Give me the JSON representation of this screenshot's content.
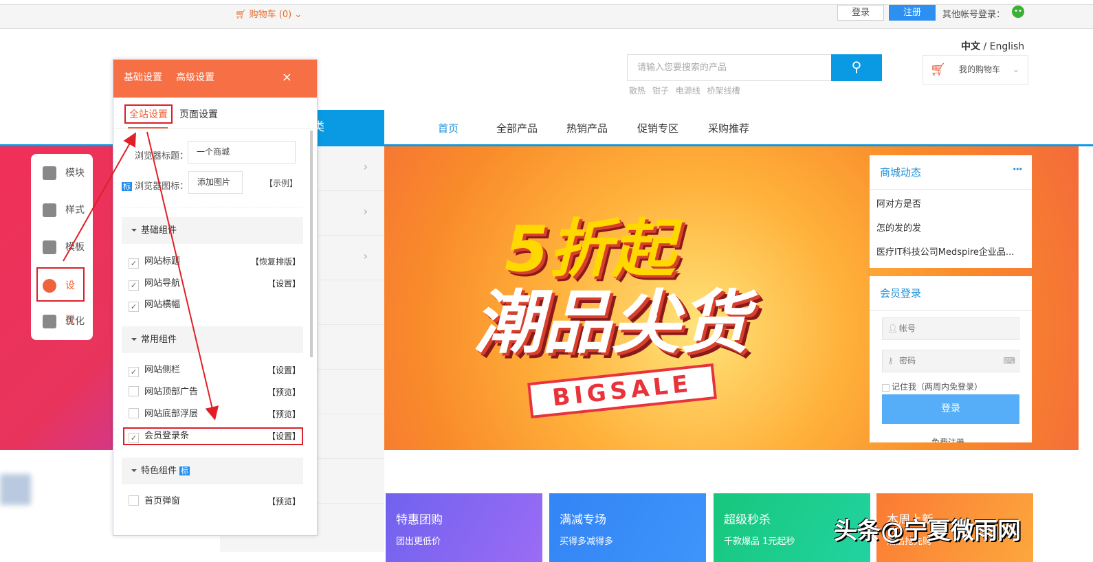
{
  "topbar": {
    "cart": "购物车 (0)",
    "login": "登录",
    "register": "注册",
    "other_login": "其他帐号登录：",
    "wechat_icon": "wechat-icon"
  },
  "header": {
    "lang_zh": "中文",
    "lang_sep": " / ",
    "lang_en": "English",
    "search_placeholder": "请输入您要搜索的产品",
    "hot": [
      "散热",
      "钳子",
      "电源线",
      "桥架线槽"
    ],
    "my_cart": "我的购物车"
  },
  "nav": {
    "category": "类",
    "items": [
      "首页",
      "全部产品",
      "热销产品",
      "促销专区",
      "采购推荐"
    ],
    "active_color": "#1d8fd6"
  },
  "banner": {
    "line1": "5折起",
    "line2": "潮品尖货",
    "tag": "BIGSALE"
  },
  "news": {
    "title": "商城动态",
    "more": "•••",
    "items": [
      "阿对方是否",
      "怎的发的发",
      "医疗IT科技公司Medspire企业品..."
    ]
  },
  "member": {
    "title": "会员登录",
    "account": "帐号",
    "password": "密码",
    "remember": "记住我（两周内免登录）",
    "login": "登录",
    "register": "免费注册"
  },
  "promos": [
    {
      "title": "特惠团购",
      "sub": "团出更低价",
      "color": "#7b61f0"
    },
    {
      "title": "满减专场",
      "sub": "买得多减得多",
      "color": "#3b8cf6"
    },
    {
      "title": "超级秒杀",
      "sub": "千款爆品 1元起秒",
      "color": "#1fcf8e"
    },
    {
      "title": "本周上新",
      "sub": "潮品抢先购",
      "color": "#fb8a3a"
    }
  ],
  "watermark": "头条@宁夏微雨网",
  "tools": [
    {
      "label": "模块"
    },
    {
      "label": "样式"
    },
    {
      "label": "模板"
    },
    {
      "label": "设置"
    },
    {
      "label": "优化"
    }
  ],
  "panel": {
    "tabs": [
      "基础设置",
      "高级设置"
    ],
    "close": "×",
    "subtabs": [
      "全站设置",
      "页面设置"
    ],
    "browser_title_label": "浏览器标题：",
    "browser_title_value": "一个商城",
    "badge": "标",
    "browser_icon_label": "浏览器图标：",
    "add_image": "添加图片",
    "example": "【示例】",
    "sections": [
      {
        "title": "基础组件",
        "rows": [
          {
            "label": "网站标题",
            "checked": true,
            "action": "【恢复排版】"
          },
          {
            "label": "网站导航",
            "checked": true,
            "action": "【设置】"
          },
          {
            "label": "网站横幅",
            "checked": true,
            "action": ""
          }
        ]
      },
      {
        "title": "常用组件",
        "rows": [
          {
            "label": "网站侧栏",
            "checked": true,
            "action": "【设置】"
          },
          {
            "label": "网站顶部广告",
            "checked": false,
            "action": "【预览】"
          },
          {
            "label": "网站底部浮层",
            "checked": false,
            "action": "【预览】"
          },
          {
            "label": "会员登录条",
            "checked": true,
            "action": "【设置】"
          }
        ]
      },
      {
        "title": "特色组件",
        "rows": [
          {
            "label": "首页弹窗",
            "checked": false,
            "action": "【预览】"
          }
        ]
      }
    ]
  }
}
